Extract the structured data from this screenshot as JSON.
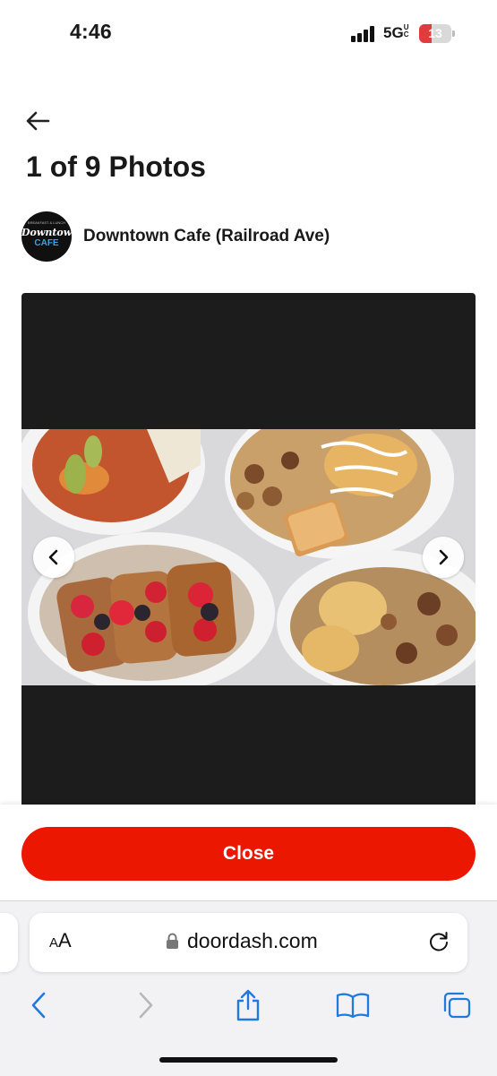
{
  "status": {
    "time": "4:46",
    "network": "5G",
    "network_suffix": "UC",
    "battery_level": "13"
  },
  "header": {
    "title": "1 of 9 Photos"
  },
  "store": {
    "name": "Downtown Cafe (Railroad Ave)",
    "logo_text_top": "BREAKFAST & LUNCH",
    "logo_text_main": "Downtown",
    "logo_text_sub": "CAFE"
  },
  "viewer": {
    "current_photo": 1,
    "total_photos": 9
  },
  "footer": {
    "close_label": "Close"
  },
  "browser": {
    "text_size_label_small": "A",
    "text_size_label_large": "A",
    "url": "doordash.com"
  },
  "colors": {
    "accent": "#eb1700",
    "ios_blue": "#1f7ae0",
    "viewer_bg": "#1c1c1c"
  },
  "icons": [
    "back-arrow-icon",
    "chevron-left-icon",
    "chevron-right-icon",
    "lock-icon",
    "reload-icon",
    "share-icon",
    "bookmarks-icon",
    "tabs-icon"
  ]
}
